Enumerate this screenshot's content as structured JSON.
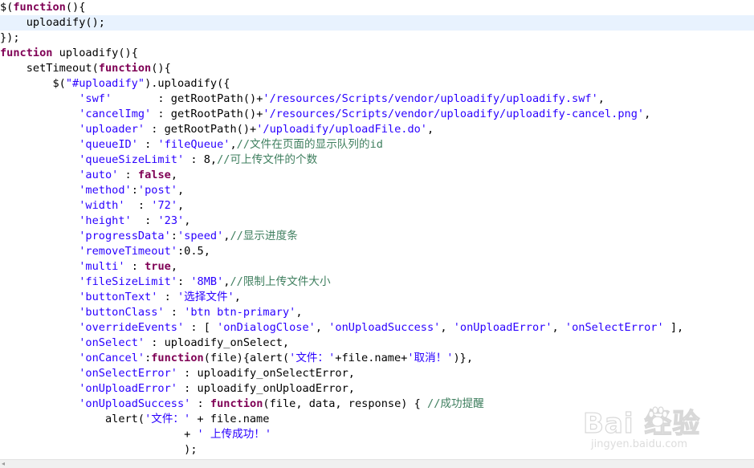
{
  "editor": {
    "lines": [
      [
        [
          "t",
          "$("
        ],
        [
          "k",
          "function"
        ],
        [
          "t",
          "(){"
        ]
      ],
      [
        [
          "t",
          "    uploadify();"
        ]
      ],
      [
        [
          "t",
          "});"
        ]
      ],
      [
        [
          "k",
          "function"
        ],
        [
          "t",
          " uploadify(){"
        ]
      ],
      [
        [
          "t",
          "    setTimeout("
        ],
        [
          "k",
          "function"
        ],
        [
          "t",
          "(){"
        ]
      ],
      [
        [
          "t",
          "        $("
        ],
        [
          "s",
          "\"#uploadify\""
        ],
        [
          "t",
          ").uploadify({"
        ]
      ],
      [
        [
          "t",
          "            "
        ],
        [
          "s",
          "'swf'"
        ],
        [
          "t",
          "       : getRootPath()+"
        ],
        [
          "s",
          "'/resources/Scripts/vendor/uploadify/uploadify.swf'"
        ],
        [
          "t",
          ","
        ]
      ],
      [
        [
          "t",
          "            "
        ],
        [
          "s",
          "'cancelImg'"
        ],
        [
          "t",
          " : getRootPath()+"
        ],
        [
          "s",
          "'/resources/Scripts/vendor/uploadify/uploadify-cancel.png'"
        ],
        [
          "t",
          ","
        ]
      ],
      [
        [
          "t",
          "            "
        ],
        [
          "s",
          "'uploader'"
        ],
        [
          "t",
          " : getRootPath()+"
        ],
        [
          "s",
          "'/uploadify/uploadFile.do'"
        ],
        [
          "t",
          ","
        ]
      ],
      [
        [
          "t",
          "            "
        ],
        [
          "s",
          "'queueID'"
        ],
        [
          "t",
          " : "
        ],
        [
          "s",
          "'fileQueue'"
        ],
        [
          "t",
          ","
        ],
        [
          "c",
          "//文件在页面的显示队列的id"
        ]
      ],
      [
        [
          "t",
          "            "
        ],
        [
          "s",
          "'queueSizeLimit'"
        ],
        [
          "t",
          " : 8,"
        ],
        [
          "c",
          "//可上传文件的个数"
        ]
      ],
      [
        [
          "t",
          "            "
        ],
        [
          "s",
          "'auto'"
        ],
        [
          "t",
          " : "
        ],
        [
          "k",
          "false"
        ],
        [
          "t",
          ","
        ]
      ],
      [
        [
          "t",
          "            "
        ],
        [
          "s",
          "'method'"
        ],
        [
          "t",
          ":"
        ],
        [
          "s",
          "'post'"
        ],
        [
          "t",
          ","
        ]
      ],
      [
        [
          "t",
          "            "
        ],
        [
          "s",
          "'width'"
        ],
        [
          "t",
          "  : "
        ],
        [
          "s",
          "'72'"
        ],
        [
          "t",
          ","
        ]
      ],
      [
        [
          "t",
          "            "
        ],
        [
          "s",
          "'height'"
        ],
        [
          "t",
          "  : "
        ],
        [
          "s",
          "'23'"
        ],
        [
          "t",
          ","
        ]
      ],
      [
        [
          "t",
          "            "
        ],
        [
          "s",
          "'progressData'"
        ],
        [
          "t",
          ":"
        ],
        [
          "s",
          "'speed'"
        ],
        [
          "t",
          ","
        ],
        [
          "c",
          "//显示进度条"
        ]
      ],
      [
        [
          "t",
          "            "
        ],
        [
          "s",
          "'removeTimeout'"
        ],
        [
          "t",
          ":0.5,"
        ]
      ],
      [
        [
          "t",
          "            "
        ],
        [
          "s",
          "'multi'"
        ],
        [
          "t",
          " : "
        ],
        [
          "k",
          "true"
        ],
        [
          "t",
          ","
        ]
      ],
      [
        [
          "t",
          "            "
        ],
        [
          "s",
          "'fileSizeLimit'"
        ],
        [
          "t",
          ": "
        ],
        [
          "s",
          "'8MB'"
        ],
        [
          "t",
          ","
        ],
        [
          "c",
          "//限制上传文件大小"
        ]
      ],
      [
        [
          "t",
          "            "
        ],
        [
          "s",
          "'buttonText'"
        ],
        [
          "t",
          " : "
        ],
        [
          "s",
          "'选择文件'"
        ],
        [
          "t",
          ","
        ]
      ],
      [
        [
          "t",
          "            "
        ],
        [
          "s",
          "'buttonClass'"
        ],
        [
          "t",
          " : "
        ],
        [
          "s",
          "'btn btn-primary'"
        ],
        [
          "t",
          ","
        ]
      ],
      [
        [
          "t",
          "            "
        ],
        [
          "s",
          "'overrideEvents'"
        ],
        [
          "t",
          " : [ "
        ],
        [
          "s",
          "'onDialogClose'"
        ],
        [
          "t",
          ", "
        ],
        [
          "s",
          "'onUploadSuccess'"
        ],
        [
          "t",
          ", "
        ],
        [
          "s",
          "'onUploadError'"
        ],
        [
          "t",
          ", "
        ],
        [
          "s",
          "'onSelectError'"
        ],
        [
          "t",
          " ],"
        ]
      ],
      [
        [
          "t",
          "            "
        ],
        [
          "s",
          "'onSelect'"
        ],
        [
          "t",
          " : uploadify_onSelect,"
        ]
      ],
      [
        [
          "t",
          "            "
        ],
        [
          "s",
          "'onCancel'"
        ],
        [
          "t",
          ":"
        ],
        [
          "k",
          "function"
        ],
        [
          "t",
          "(file){alert("
        ],
        [
          "s",
          "'文件：'"
        ],
        [
          "t",
          "+file.name+"
        ],
        [
          "s",
          "'取消！'"
        ],
        [
          "t",
          ")},"
        ]
      ],
      [
        [
          "t",
          "            "
        ],
        [
          "s",
          "'onSelectError'"
        ],
        [
          "t",
          " : uploadify_onSelectError,"
        ]
      ],
      [
        [
          "t",
          "            "
        ],
        [
          "s",
          "'onUploadError'"
        ],
        [
          "t",
          " : uploadify_onUploadError,"
        ]
      ],
      [
        [
          "t",
          "            "
        ],
        [
          "s",
          "'onUploadSuccess'"
        ],
        [
          "t",
          " : "
        ],
        [
          "k",
          "function"
        ],
        [
          "t",
          "(file, data, response) { "
        ],
        [
          "c",
          "//成功提醒"
        ]
      ],
      [
        [
          "t",
          "                alert("
        ],
        [
          "s",
          "'文件：'"
        ],
        [
          "t",
          " + file.name"
        ]
      ],
      [
        [
          "t",
          "                            + "
        ],
        [
          "s",
          "' 上传成功！'"
        ]
      ],
      [
        [
          "t",
          "                            );"
        ]
      ]
    ],
    "current_line": 1
  },
  "watermark": {
    "brand": "Bai  经验",
    "sub": "jingyen.baidu.com"
  },
  "scrollbar": {
    "left_arrow": "◂"
  }
}
